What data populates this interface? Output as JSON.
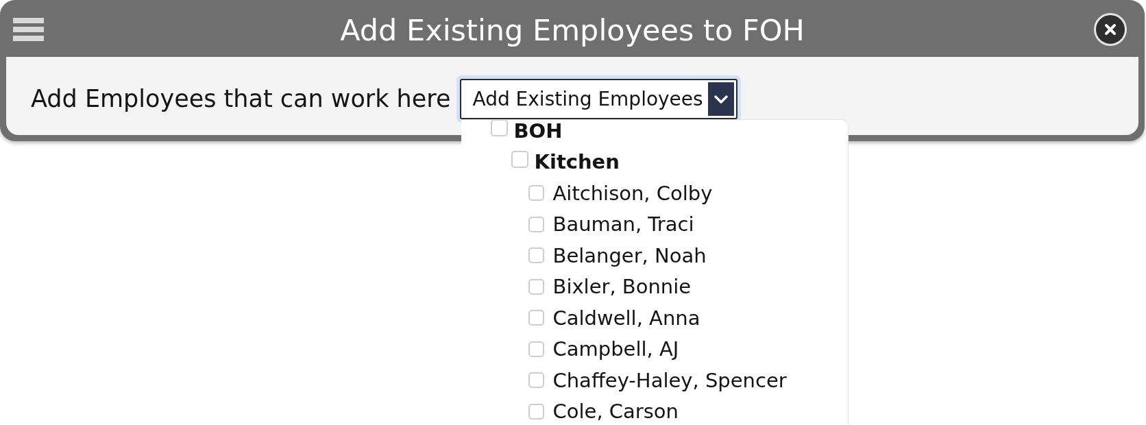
{
  "window": {
    "title": "Add Existing Employees to FOH"
  },
  "form": {
    "label": "Add Employees that can work here",
    "select": {
      "value": "Add Existing Employees",
      "expanded": true
    },
    "options": [
      {
        "label": "BOH",
        "checked": false,
        "children": [
          {
            "label": "Kitchen",
            "checked": false,
            "children": [
              {
                "label": "Aitchison, Colby",
                "checked": false
              },
              {
                "label": "Bauman, Traci",
                "checked": false
              },
              {
                "label": "Belanger, Noah",
                "checked": false
              },
              {
                "label": "Bixler, Bonnie",
                "checked": false
              },
              {
                "label": "Caldwell, Anna",
                "checked": false
              },
              {
                "label": "Campbell, AJ",
                "checked": false
              },
              {
                "label": "Chaffey-Haley, Spencer",
                "checked": false
              },
              {
                "label": "Cole, Carson",
                "checked": false
              }
            ]
          }
        ]
      }
    ]
  }
}
